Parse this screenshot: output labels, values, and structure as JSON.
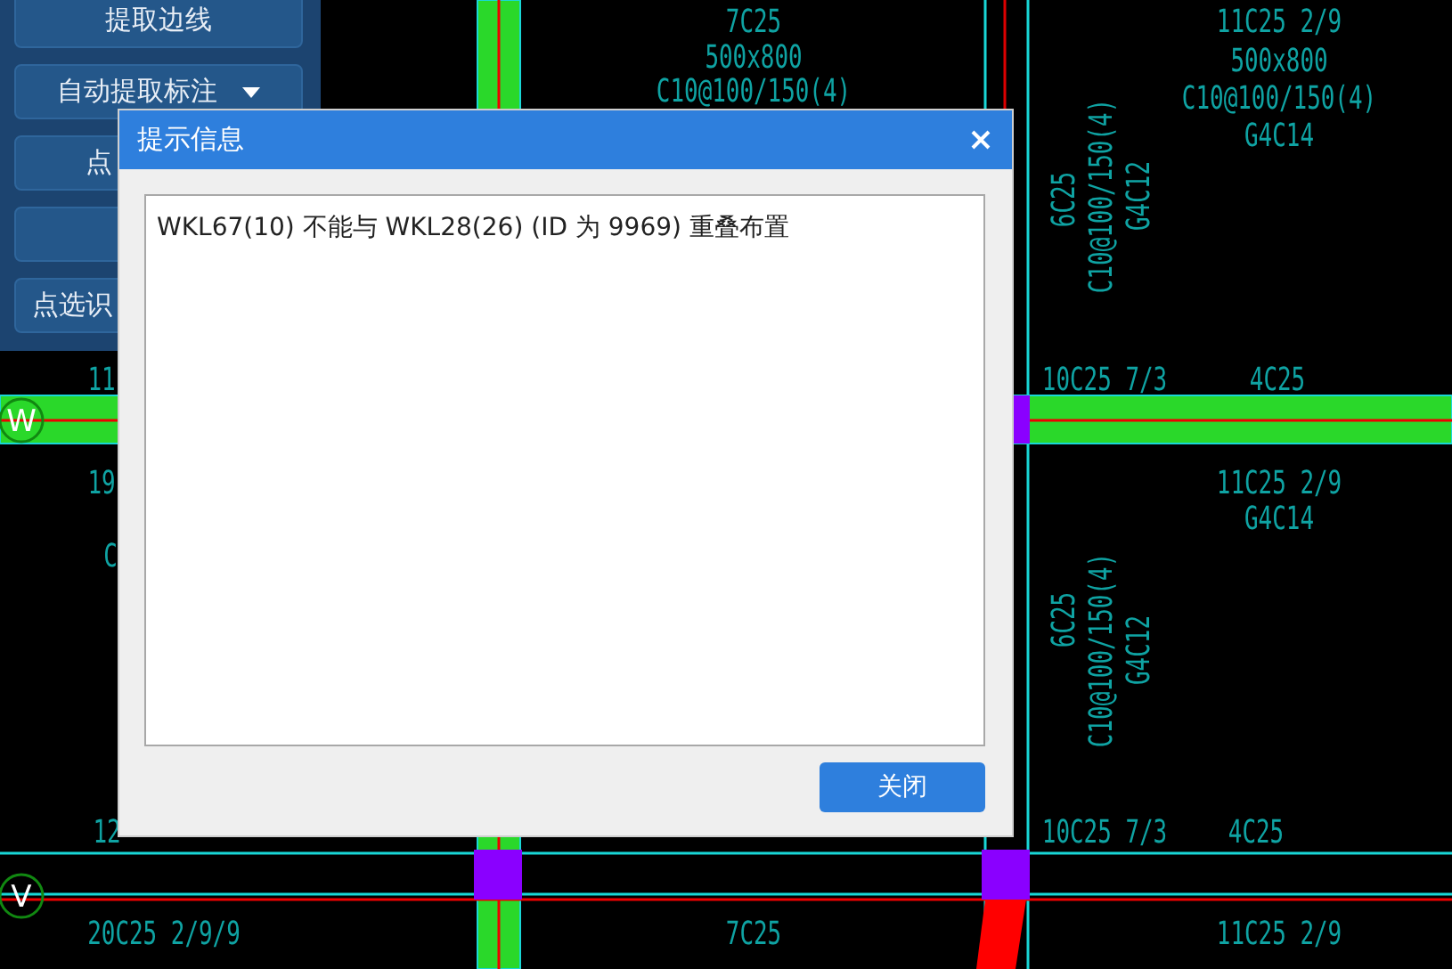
{
  "side_panel": {
    "buttons": [
      {
        "label": "提取边线",
        "dropdown": false,
        "kind": "full"
      },
      {
        "label": "自动提取标注",
        "dropdown": true,
        "kind": "full"
      },
      {
        "label": "点",
        "dropdown": false,
        "kind": "covered"
      },
      {
        "dropdown": false,
        "kind": "covered"
      },
      {
        "label": "点选识",
        "dropdown": false,
        "kind": "covered"
      }
    ]
  },
  "drawing": {
    "axes": [
      {
        "label": "W"
      },
      {
        "label": "V"
      }
    ],
    "labels": [
      {
        "text": "7C25",
        "kind": "horizontal"
      },
      {
        "text": "500x800",
        "kind": "horizontal"
      },
      {
        "text": "C10@100/150(4)",
        "kind": "horizontal"
      },
      {
        "text": "11C25 2/9",
        "kind": "horizontal"
      },
      {
        "text": "500x800",
        "kind": "horizontal"
      },
      {
        "text": "C10@100/150(4)",
        "kind": "horizontal"
      },
      {
        "text": "G4C14",
        "kind": "horizontal"
      },
      {
        "text": "6C25",
        "kind": "vertical"
      },
      {
        "text": "C10@100/150(4)",
        "kind": "vertical"
      },
      {
        "text": "G4C12",
        "kind": "vertical"
      },
      {
        "text": "11",
        "kind": "horizontal"
      },
      {
        "text": "10C25 7/3",
        "kind": "horizontal"
      },
      {
        "text": "4C25",
        "kind": "horizontal"
      },
      {
        "text": "19",
        "kind": "horizontal"
      },
      {
        "text": "C",
        "kind": "horizontal"
      },
      {
        "text": "11C25 2/9",
        "kind": "horizontal"
      },
      {
        "text": "G4C14",
        "kind": "horizontal"
      },
      {
        "text": "6C25",
        "kind": "vertical"
      },
      {
        "text": "C10@100/150(4)",
        "kind": "vertical"
      },
      {
        "text": "G4C12",
        "kind": "vertical"
      },
      {
        "text": "12",
        "kind": "horizontal"
      },
      {
        "text": "10C25 7/3",
        "kind": "horizontal"
      },
      {
        "text": "4C25",
        "kind": "horizontal"
      },
      {
        "text": "20C25 2/9/9",
        "kind": "horizontal"
      },
      {
        "text": "7C25",
        "kind": "horizontal"
      },
      {
        "text": "11C25 2/9",
        "kind": "horizontal"
      }
    ]
  },
  "dialog": {
    "title": "提示信息",
    "message": "WKL67(10) 不能与 WKL28(26) (ID 为 9969) 重叠布置",
    "buttons": [
      "关闭"
    ]
  }
}
